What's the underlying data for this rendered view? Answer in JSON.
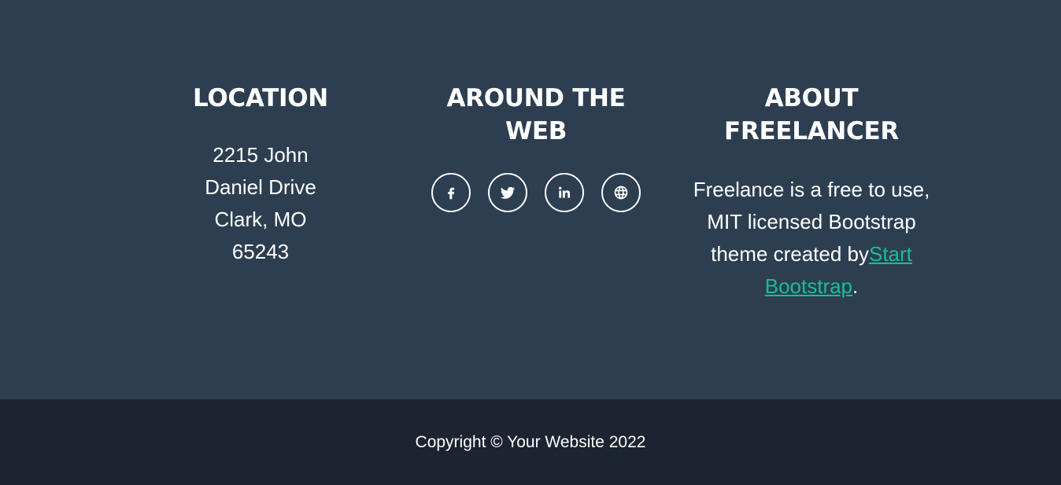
{
  "footer": {
    "location": {
      "heading": "LOCATION",
      "address_lines": [
        "2215 John",
        "Daniel Drive",
        "Clark, MO",
        "65243"
      ]
    },
    "web": {
      "heading": "AROUND THE WEB",
      "social": [
        {
          "icon": "facebook-icon",
          "label": "f"
        },
        {
          "icon": "twitter-icon",
          "label": "twitter"
        },
        {
          "icon": "linkedin-icon",
          "label": "in"
        },
        {
          "icon": "globe-icon",
          "label": "globe"
        }
      ]
    },
    "about": {
      "heading": "ABOUT FREELANCER",
      "text_before_link": "Freelance is a free to use, MIT licensed Bootstrap theme created by",
      "link_text": "Start Bootstrap",
      "text_after_link": "."
    }
  },
  "copyright": {
    "text": "Copyright © Your Website 2022"
  },
  "colors": {
    "footer_bg": "#2c3e50",
    "copyright_bg": "#1b2430",
    "link": "#1abc9c",
    "text": "#ffffff"
  }
}
